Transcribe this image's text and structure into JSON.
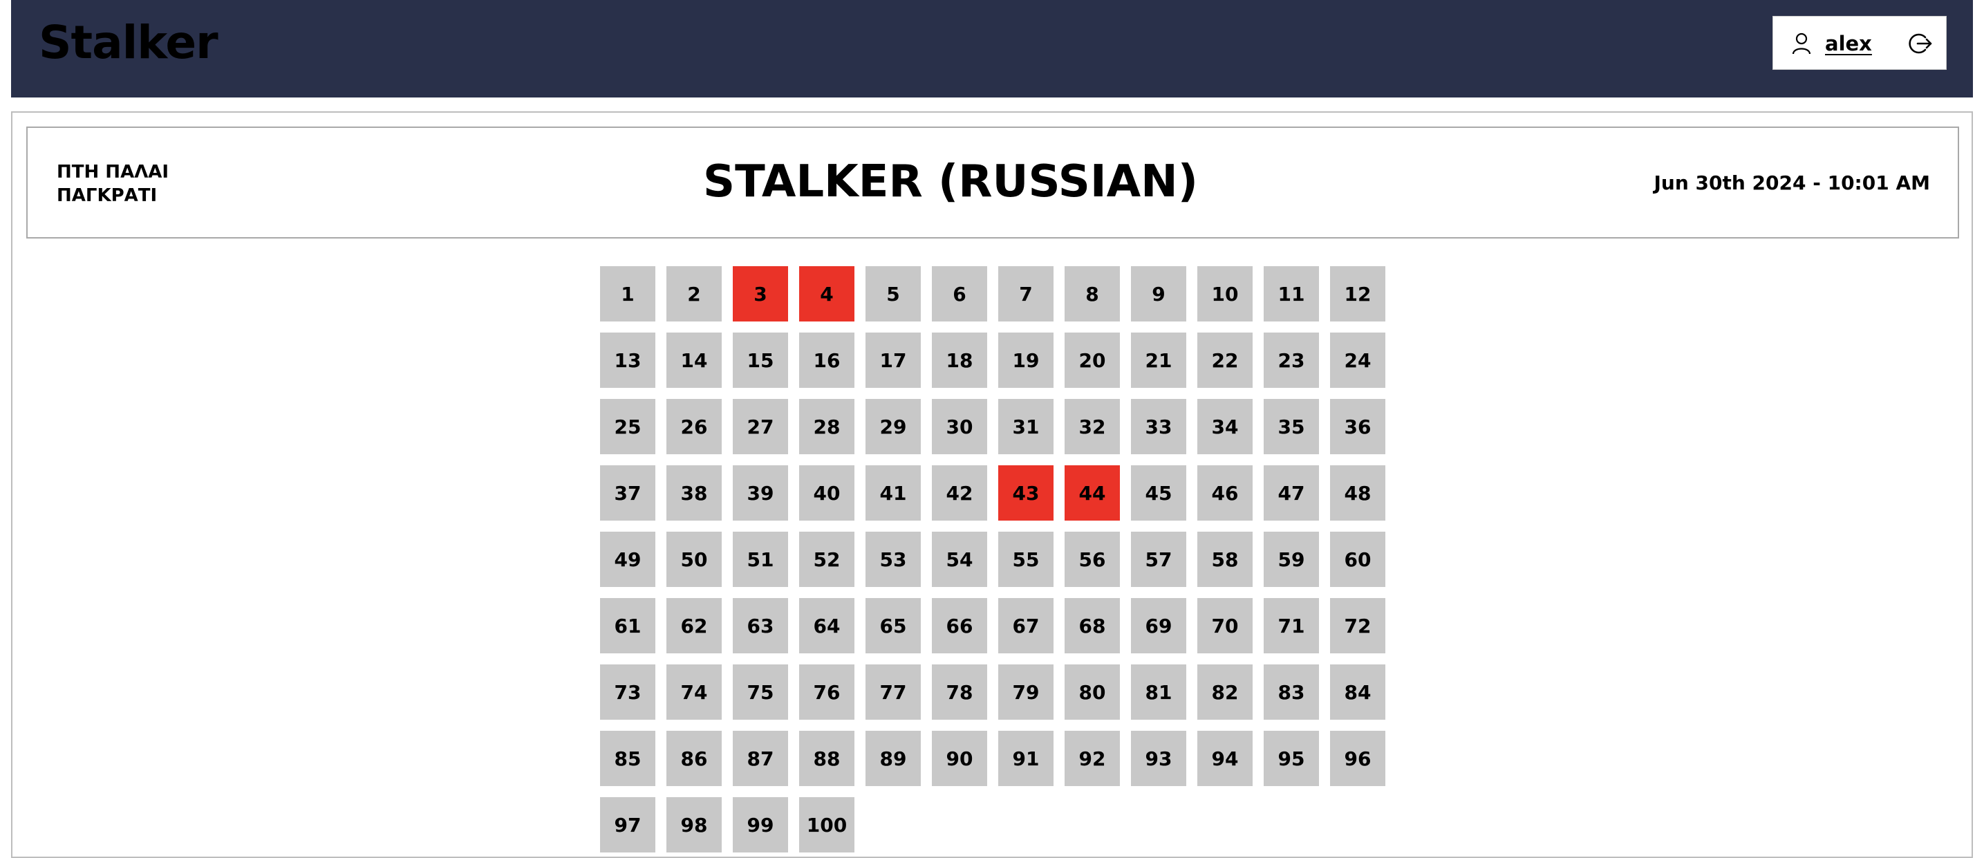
{
  "header": {
    "brand": "Stalker",
    "username": "alex",
    "user_icon": "user-icon",
    "logout_icon": "logout-icon"
  },
  "info": {
    "venue_line1": "ΠΤΗ ΠΑΛΑΙ",
    "venue_line2": "ΠΑΓΚΡΑΤΙ",
    "movie_title": "STALKER (RUSSIAN)",
    "datetime": "Jun 30th 2024 - 10:01 AM"
  },
  "colors": {
    "header_bg": "#29304a",
    "seat_available": "#c8c8c8",
    "seat_taken": "#ea3328"
  },
  "seats": {
    "count": 100,
    "taken": [
      3,
      4,
      43,
      44
    ]
  }
}
